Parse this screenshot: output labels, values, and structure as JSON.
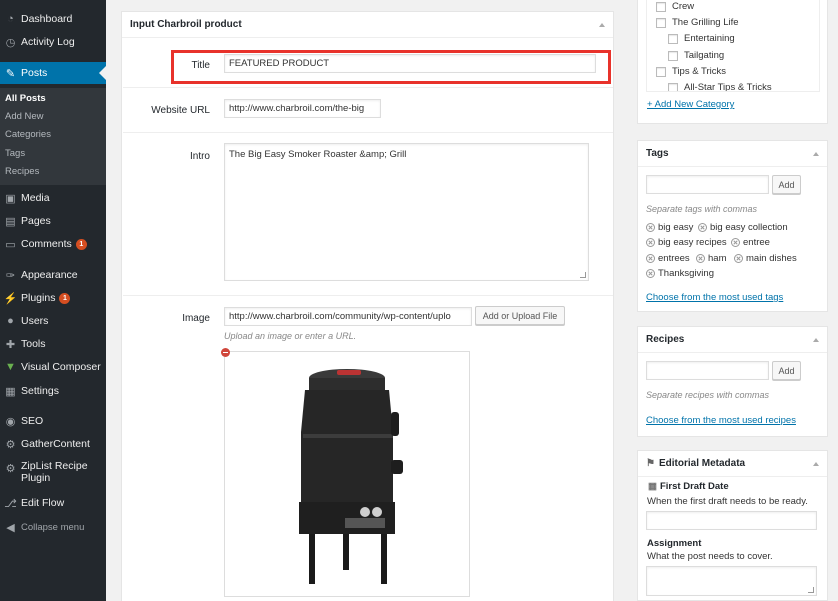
{
  "menu": {
    "items": [
      {
        "label": "Dashboard",
        "icon": "dashboard-icon"
      },
      {
        "label": "Activity Log",
        "icon": "history-icon"
      },
      {
        "label": "Posts",
        "icon": "pin-icon"
      },
      {
        "label": "Media",
        "icon": "media-icon"
      },
      {
        "label": "Pages",
        "icon": "pages-icon"
      },
      {
        "label": "Comments",
        "icon": "comments-icon",
        "badge": "1"
      },
      {
        "label": "Appearance",
        "icon": "appearance-icon"
      },
      {
        "label": "Plugins",
        "icon": "plugins-icon",
        "badge": "1"
      },
      {
        "label": "Users",
        "icon": "users-icon"
      },
      {
        "label": "Tools",
        "icon": "tools-icon"
      },
      {
        "label": "Visual Composer",
        "icon": "visual-composer-icon"
      },
      {
        "label": "Settings",
        "icon": "settings-icon"
      },
      {
        "label": "SEO",
        "icon": "seo-icon"
      },
      {
        "label": "GatherContent",
        "icon": "gathercontent-icon"
      },
      {
        "label": "ZipList Recipe Plugin",
        "label_line1": "ZipList Recipe",
        "label_line2": "Plugin",
        "icon": "ziplist-icon"
      },
      {
        "label": "Edit Flow",
        "icon": "edit-flow-icon"
      }
    ],
    "submenu": [
      "All Posts",
      "Add New",
      "Categories",
      "Tags",
      "Recipes"
    ],
    "collapse_label": "Collapse menu",
    "accent_color": "#0073aa"
  },
  "main_box": {
    "title": "Input Charbroil product",
    "fields": {
      "title": {
        "label": "Title",
        "value": "FEATURED PRODUCT"
      },
      "website_url": {
        "label": "Website URL",
        "value": "http://www.charbroil.com/the-big"
      },
      "intro": {
        "label": "Intro",
        "value": "The Big Easy Smoker Roaster &amp; Grill"
      },
      "image": {
        "label": "Image",
        "value": "http://www.charbroil.com/community/wp-content/uplo",
        "button": "Add or Upload File",
        "hint": "Upload an image or enter a URL."
      }
    },
    "highlight_color": "#e8322b"
  },
  "categories": {
    "items": [
      "Crew",
      "The Grilling Life",
      "Entertaining",
      "Tailgating",
      "Tips & Tricks",
      "All-Star Tips & Tricks"
    ],
    "add_new": "+ Add New Category"
  },
  "tags_box": {
    "title": "Tags",
    "add_button": "Add",
    "hint": "Separate tags with commas",
    "tags": [
      "big easy",
      "big easy collection",
      "big easy recipes",
      "entree",
      "entrees",
      "ham",
      "main dishes",
      "Thanksgiving"
    ],
    "most_used": "Choose from the most used tags"
  },
  "recipes_box": {
    "title": "Recipes",
    "add_button": "Add",
    "hint": "Separate recipes with commas",
    "most_used": "Choose from the most used recipes"
  },
  "metadata_box": {
    "title": "Editorial Metadata",
    "first_draft": {
      "label": "First Draft Date",
      "desc": "When the first draft needs to be ready."
    },
    "assignment": {
      "label": "Assignment",
      "desc": "What the post needs to cover."
    }
  }
}
